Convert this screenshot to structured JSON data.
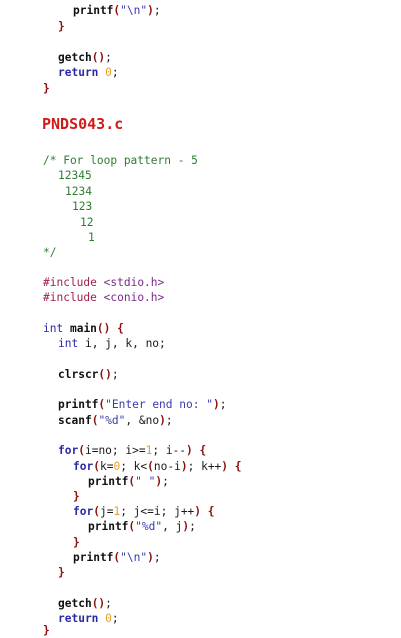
{
  "section_title": "PNDS043.c",
  "top_code": {
    "printf_newline": "printf(\"\\n\");",
    "close_brace_inner": "}",
    "getch": "getch();",
    "return_kw": "return",
    "return_val": "0;",
    "close_brace_outer": "}"
  },
  "comment": {
    "line1": "/* For loop pattern - 5",
    "rows": [
      "12345",
      "1234",
      "123",
      "12",
      "1"
    ],
    "end": "*/"
  },
  "includes": [
    "#include <stdio.h>",
    "#include <conio.h>"
  ],
  "main": {
    "signature": "int main() {",
    "decl": "int i, j, k, no;",
    "clrscr": "clrscr();",
    "printf_prompt": "printf(\"Enter end no: \");",
    "scanf": "scanf(\"%d\", &no);",
    "for_i": "for(i=no; i>=1; i--) {",
    "for_k": "for(k=0; k<(no-i); k++) {",
    "printf_space": "printf(\" \");",
    "close_k": "}",
    "for_j": "for(j=1; j<=i; j++) {",
    "printf_d": "printf(\"%d\", j);",
    "close_j": "}",
    "printf_nl": "printf(\"\\n\");",
    "close_i": "}",
    "getch": "getch();",
    "return_kw": "return",
    "return_val": "0;",
    "close_main": "}"
  }
}
